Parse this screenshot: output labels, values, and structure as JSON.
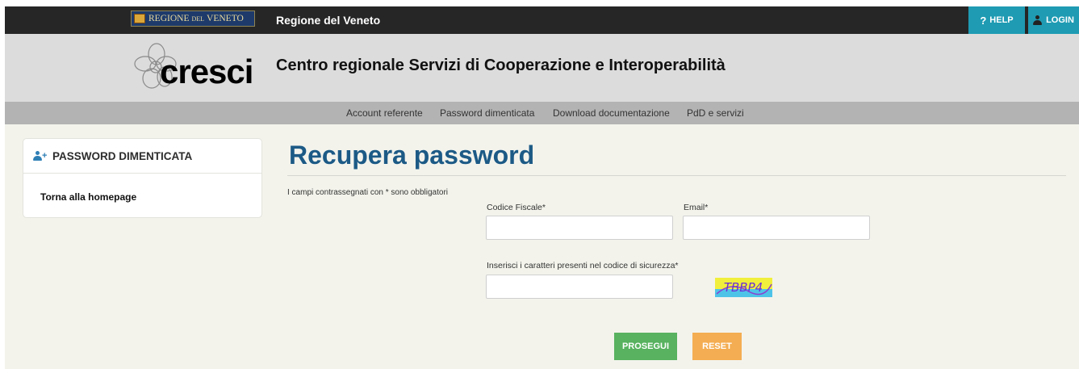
{
  "topbar": {
    "region_logo": {
      "part1": "REGIONE",
      "part2": "DEL",
      "part3": "VENETO"
    },
    "title": "Regione del Veneto",
    "help": {
      "icon": "?",
      "label": "HELP"
    },
    "login": {
      "label": "LOGIN"
    }
  },
  "header": {
    "logo_text": "cresci",
    "title": "Centro regionale Servizi di Cooperazione e Interoperabilità"
  },
  "nav": {
    "items": [
      {
        "label": "Account referente"
      },
      {
        "label": "Password dimenticata"
      },
      {
        "label": "Download documentazione"
      },
      {
        "label": "PdD e servizi"
      }
    ]
  },
  "sidebar": {
    "heading": "PASSWORD DIMENTICATA",
    "link": "Torna alla homepage"
  },
  "main": {
    "title": "Recupera password",
    "required_note": "I campi contrassegnati con * sono obbligatori",
    "codice_fiscale": {
      "label": "Codice Fiscale*",
      "value": ""
    },
    "email": {
      "label": "Email*",
      "value": ""
    },
    "captcha_input": {
      "label": "Inserisci i caratteri presenti nel codice di sicurezza*",
      "value": ""
    },
    "captcha_text": "TBBP4",
    "submit_label": "PROSEGUI",
    "reset_label": "RESET"
  },
  "colors": {
    "topbar_bg": "#262626",
    "accent_teal": "#1f9bb3",
    "title_blue": "#1c5a86",
    "submit_green": "#58b25f",
    "reset_orange": "#f4ad52",
    "page_bg": "#f3f3ec"
  }
}
